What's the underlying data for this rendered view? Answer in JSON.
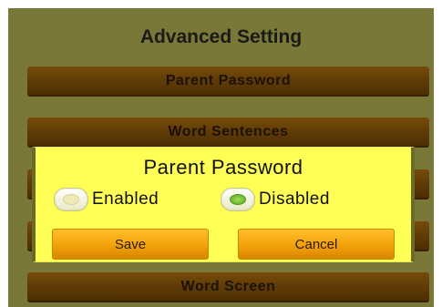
{
  "screen": {
    "title": "Advanced Setting",
    "menu": [
      {
        "label": "Parent Password"
      },
      {
        "label": "Word Sentences"
      },
      {
        "label": ""
      },
      {
        "label": ""
      },
      {
        "label": "Word Screen"
      }
    ]
  },
  "dialog": {
    "title": "Parent Password",
    "options": [
      {
        "label": "Enabled",
        "selected": false
      },
      {
        "label": "Disabled",
        "selected": true
      }
    ],
    "save_label": "Save",
    "cancel_label": "Cancel"
  },
  "colors": {
    "background": "#7f7d3a",
    "menu_button": "#6a4207",
    "dialog": "#ffff55",
    "dialog_button": "#f2a10a",
    "radio_selected": "#5aa81e"
  }
}
